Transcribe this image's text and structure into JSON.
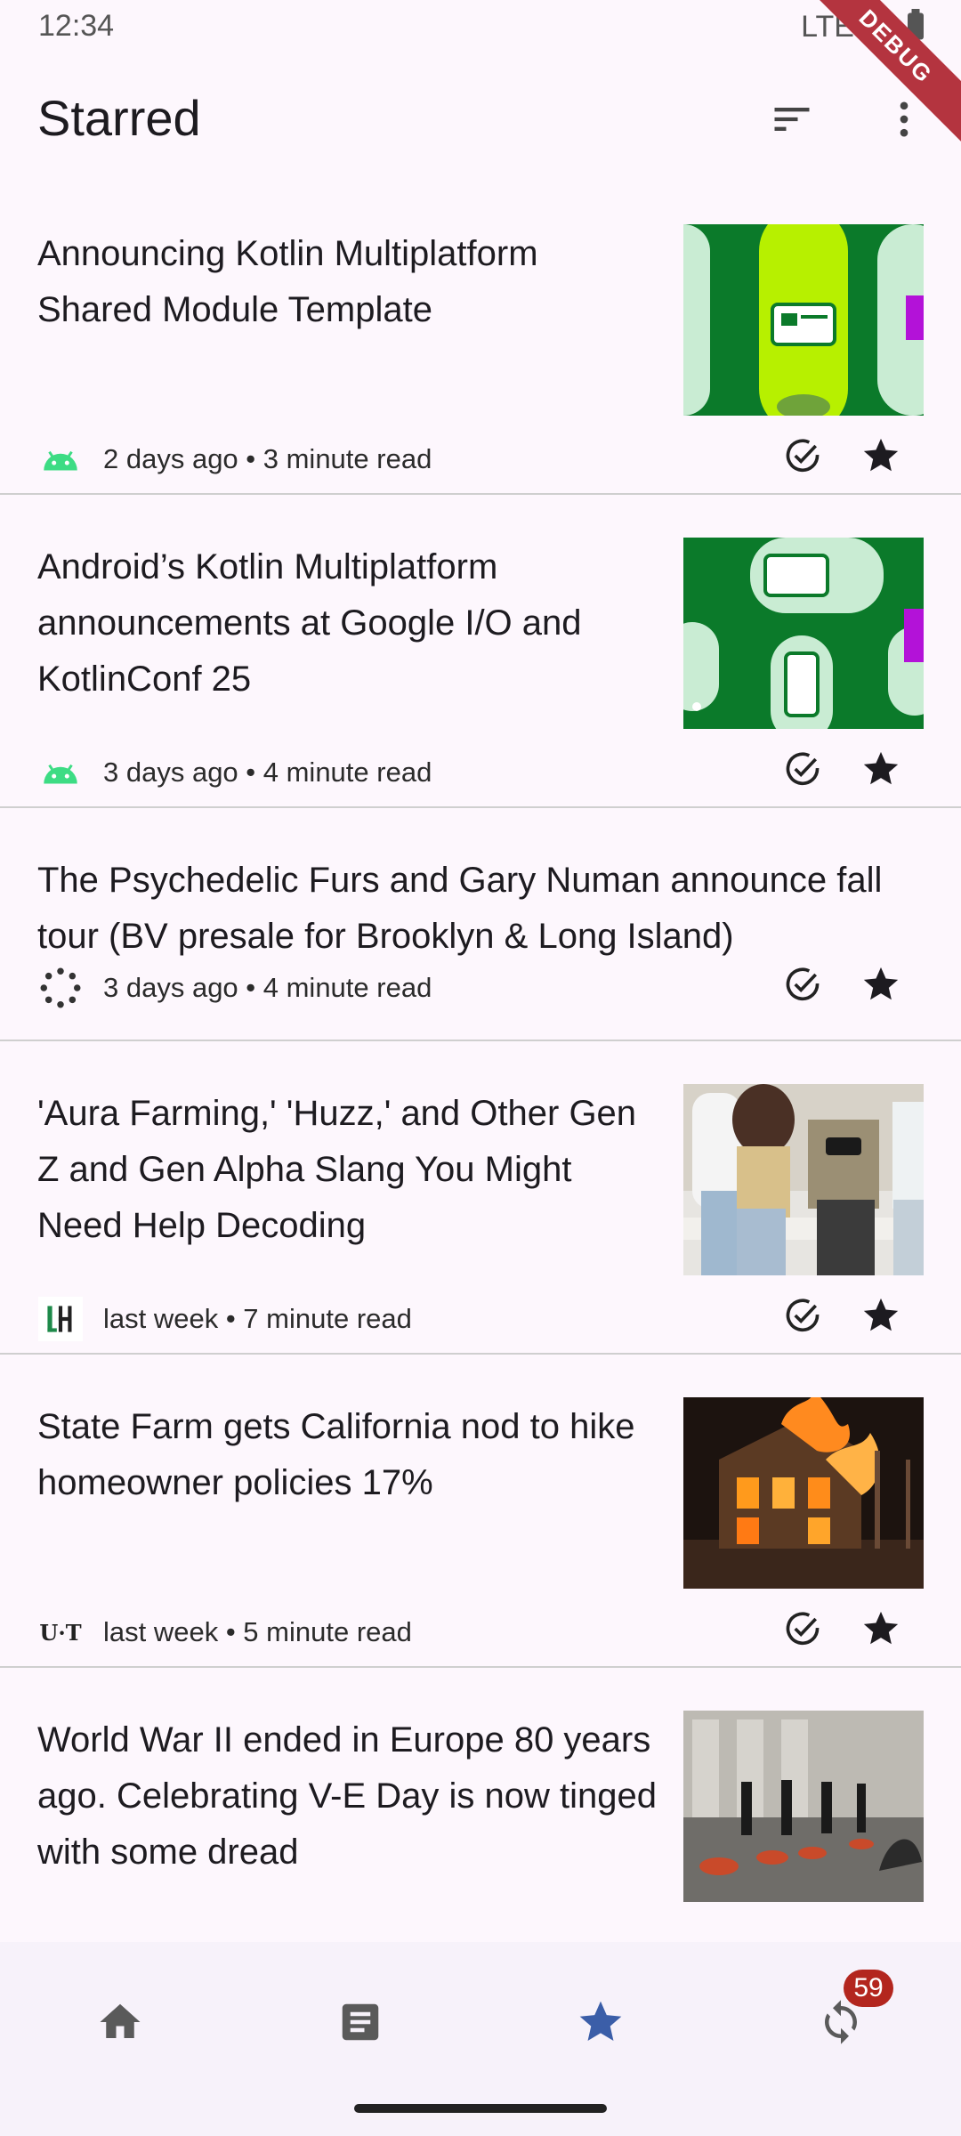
{
  "status_bar": {
    "time": "12:34",
    "network": "LTE",
    "debug_label": "DEBUG"
  },
  "app_bar": {
    "title": "Starred",
    "sort_icon": "sort-icon",
    "more_icon": "more-vert-icon"
  },
  "articles": [
    {
      "title": "Announcing Kotlin Multiplatform Shared Module Template",
      "meta": "2 days ago • 3 minute read",
      "source_icon": "android-icon",
      "has_image": true
    },
    {
      "title": "Android’s Kotlin Multiplatform announcements at Google I/O and KotlinConf 25",
      "meta": "3 days ago • 4 minute read",
      "source_icon": "android-icon",
      "has_image": true
    },
    {
      "title": "The Psychedelic Furs and Gary Numan announce fall tour (BV presale for Brooklyn & Long Island)",
      "meta": "3 days ago • 4 minute read",
      "source_icon": "loading-dots-icon",
      "has_image": false
    },
    {
      "title": "'Aura Farming,' 'Huzz,' and Other Gen Z and Gen Alpha Slang You Might Need Help Decoding",
      "meta": "last week • 7 minute read",
      "source_icon": "lh-logo-icon",
      "has_image": true
    },
    {
      "title": "State Farm gets California nod to hike homeowner policies 17%",
      "meta": "last week • 5 minute read",
      "source_icon": "usa-today-logo-icon",
      "source_logo_text": "U·T",
      "has_image": true
    },
    {
      "title": "World War II ended in Europe 80 years ago. Celebrating V-E Day is now tinged with some dread",
      "meta": "",
      "source_icon": "",
      "has_image": true
    }
  ],
  "bottom_nav": {
    "items": [
      {
        "icon": "home-icon",
        "selected": false
      },
      {
        "icon": "article-icon",
        "selected": false
      },
      {
        "icon": "star-icon",
        "selected": true
      },
      {
        "icon": "sync-icon",
        "selected": false,
        "badge": "59"
      }
    ]
  },
  "colors": {
    "accent": "#3b5ea8",
    "badge": "#b3261e",
    "background": "#fdf7fd",
    "nav_background": "#f7f2fa"
  }
}
